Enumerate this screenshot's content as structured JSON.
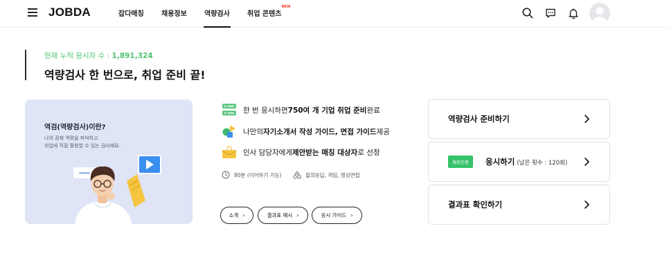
{
  "header": {
    "logo": "JOBDA",
    "nav": [
      {
        "label": "잡다매칭"
      },
      {
        "label": "채용정보"
      },
      {
        "label": "역량검사"
      },
      {
        "label": "취업 콘텐츠"
      }
    ],
    "new_badge": "NEW",
    "icons": [
      "search-icon",
      "message-icon",
      "bell-icon",
      "avatar-icon"
    ]
  },
  "summary": {
    "count_label": "현재 누적 응시자 수 : ",
    "count_value": "1,891,324",
    "headline": "역량검사 한 번으로, 취업 준비 끝!"
  },
  "intro_card": {
    "title": "역검(역량검사)이란?",
    "desc_line1": "나의 잠재 역량을 파악하고",
    "desc_line2": "취업에 직접 활용할 수 있는 검사예요."
  },
  "features": [
    {
      "pre": "한 번 응시하면 ",
      "bold": "750여 개 기업 취업 준비",
      "post": " 완료",
      "icon": "list-icon"
    },
    {
      "pre": "나만의 ",
      "bold": "자기소개서 작성 가이드, 면접 가이드",
      "post": " 제공",
      "icon": "shapes-icon"
    },
    {
      "pre": "인사 담당자에게 ",
      "bold": "제안받는 매칭 대상자",
      "post": "로 선정",
      "icon": "envelope-icon"
    }
  ],
  "meta": {
    "time": "80분 (이어하기 가능)",
    "types": "질의응답, 게임, 영상면접"
  },
  "pills": [
    {
      "label": "소개"
    },
    {
      "label": "결과표 예시"
    },
    {
      "label": "응시 가이드"
    }
  ],
  "actions": {
    "prepare": "역량검사 준비하기",
    "badge": "제휴인증",
    "take": "응시하기",
    "take_sub": "(남은 횟수 : 120회)",
    "result": "결과표 확인하기"
  },
  "colors": {
    "accent_green": "#52c471",
    "badge_green": "#35c26a",
    "card_bg": "#dfe4f7"
  }
}
